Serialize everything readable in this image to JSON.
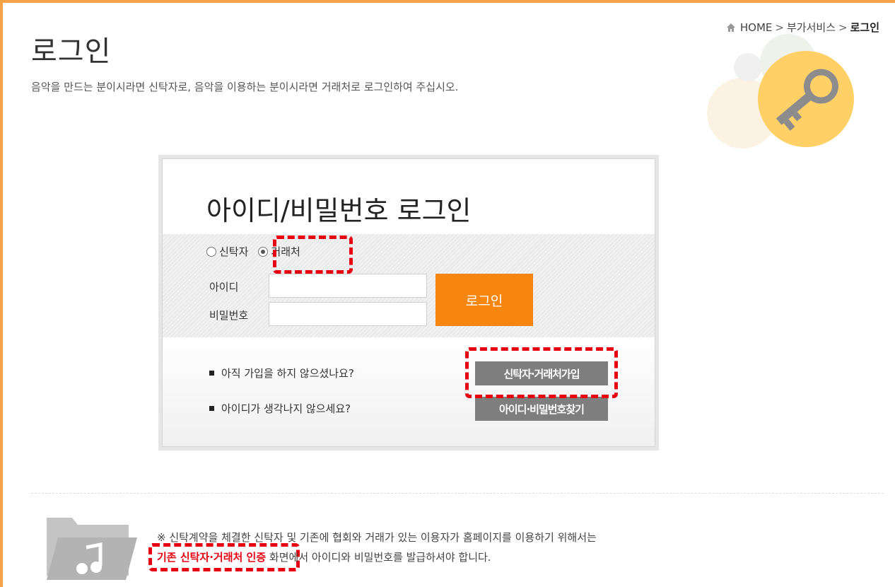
{
  "page": {
    "title": "로그인",
    "description": "음악을 만드는 분이시라면 신탁자로, 음악을 이용하는 분이시라면 거래처로 로그인하여 주십시오."
  },
  "breadcrumb": {
    "home": "HOME",
    "sep1": ">",
    "section": "부가서비스",
    "sep2": ">",
    "current": "로그인"
  },
  "login": {
    "heading": "아이디/비밀번호 로그인",
    "radio_truster": "신탁자",
    "radio_client": "거래처",
    "selected": "거래처",
    "id_label": "아이디",
    "password_label": "비밀번호",
    "id_value": "",
    "password_value": "",
    "login_button": "로그인"
  },
  "help": {
    "signup_question": "아직 가입을 하지 않으셨나요?",
    "signup_button": "신탁자·거래처가입",
    "find_question": "아이디가 생각나지 않으세요?",
    "find_button": "아이디·비밀번호찾기"
  },
  "notice": {
    "line1": "※ 신탁계약을 체결한 신탁자 및 기존에 협회와 거래가 있는 이용자가 홈페이지를 이용하기 위해서는",
    "link": "기존 신탁자·거래처 인증",
    "line2_rest": " 화면에서 아이디와 비밀번호를 발급하셔야 합니다."
  },
  "colors": {
    "accent_orange": "#f7860f",
    "frame_orange": "#f5a146",
    "highlight_red": "#e60012",
    "grey_button": "#7e7e7e"
  },
  "icons": [
    "home-icon",
    "key-icon",
    "folder-music-icon"
  ]
}
